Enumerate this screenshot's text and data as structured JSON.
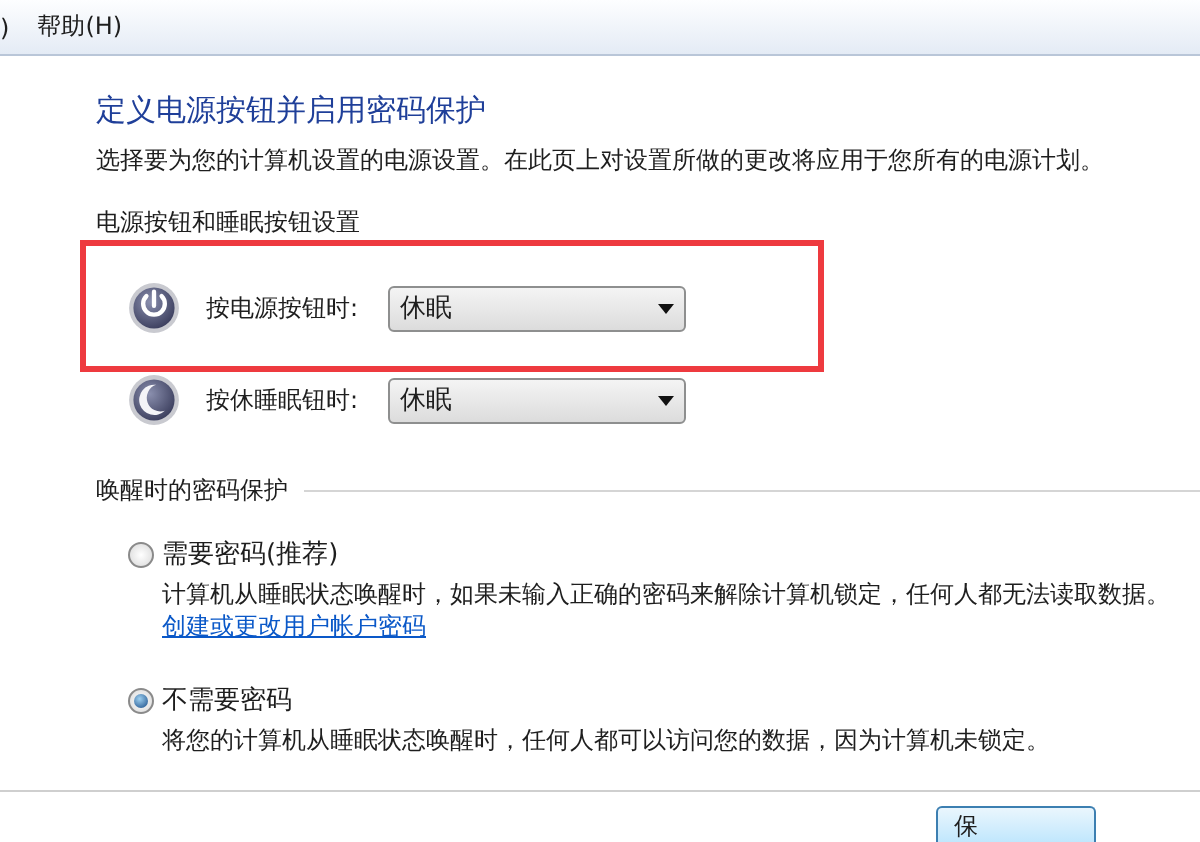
{
  "menu": [
    {
      "label": ")"
    },
    {
      "label": "帮助(H)"
    }
  ],
  "heading": "定义电源按钮并启用密码保护",
  "description": "选择要为您的计算机设置的电源设置。在此页上对设置所做的更改将应用于您所有的电源计划。",
  "button_section": {
    "title": "电源按钮和睡眠按钮设置",
    "rows": [
      {
        "kind": "power",
        "label": "按电源按钮时:",
        "value": "休眠"
      },
      {
        "kind": "sleep",
        "label": "按休睡眠钮时:",
        "value": "休眠"
      }
    ]
  },
  "password_section": {
    "title": "唤醒时的密码保护",
    "options": [
      {
        "label": "需要密码(推荐)",
        "selected": false,
        "description": "计算机从睡眠状态唤醒时，如果未输入正确的密码来解除计算机锁定，任何人都无法读取数据。",
        "link": "创建或更改用户帐户密码"
      },
      {
        "label": "不需要密码",
        "selected": true,
        "description": "将您的计算机从睡眠状态唤醒时，任何人都可以访问您的数据，因为计算机未锁定。"
      }
    ]
  },
  "buttons": [
    "保"
  ]
}
